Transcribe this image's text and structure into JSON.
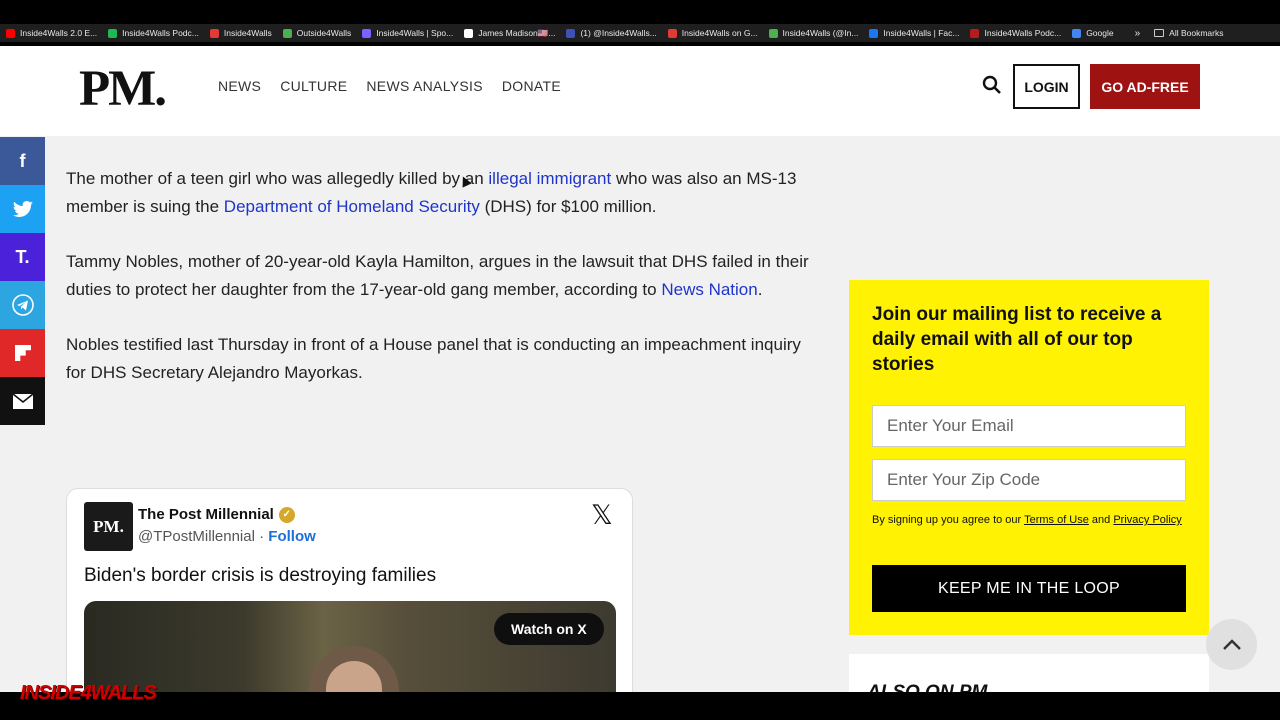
{
  "bookmarks": {
    "items": [
      {
        "label": "Inside4Walls 2.0 E...",
        "color": "#ff0000"
      },
      {
        "label": "Inside4Walls Podc...",
        "color": "#1db954"
      },
      {
        "label": "Inside4Walls",
        "color": "#e53935"
      },
      {
        "label": "Outside4Walls",
        "color": "#4caf50"
      },
      {
        "label": "Inside4Walls | Spo...",
        "color": "#7b61ff"
      },
      {
        "label": "James Madison🇺🇸...",
        "color": "#ffffff"
      },
      {
        "label": "(1) @Inside4Walls...",
        "color": "#3f51b5"
      },
      {
        "label": "Inside4Walls on G...",
        "color": "#e53935"
      },
      {
        "label": "Inside4Walls (@In...",
        "color": "#4caf50"
      },
      {
        "label": "Inside4Walls | Fac...",
        "color": "#1877f2"
      },
      {
        "label": "Inside4Walls Podc...",
        "color": "#b71c1c"
      },
      {
        "label": "Google",
        "color": "#4285f4"
      }
    ],
    "more": "»",
    "all_label": "All Bookmarks"
  },
  "header": {
    "logo": "PM.",
    "nav": [
      "NEWS",
      "CULTURE",
      "NEWS ANALYSIS",
      "DONATE"
    ],
    "login": "LOGIN",
    "ad_free": "GO AD-FREE",
    "accent_color": "#9e1212"
  },
  "share": [
    "facebook-icon",
    "twitter-icon",
    "truth-social-icon",
    "telegram-icon",
    "flipboard-icon",
    "email-icon"
  ],
  "article": {
    "p1_a": "The mother of a teen girl who was allegedly killed by an ",
    "p1_link1": "illegal immigrant",
    "p1_b": " who was also an MS-13 member is suing the ",
    "p1_link2": "Department of Homeland Security",
    "p1_c": " (DHS) for $100 million.",
    "p2_a": "Tammy Nobles, mother of 20-year-old Kayla Hamilton, argues in the lawsuit that DHS failed in their duties to protect her daughter from the 17-year-old gang member, according to ",
    "p2_link": "News Nation",
    "p2_b": ".",
    "p3": "Nobles testified last Thursday in front of a House panel that is conducting an impeachment inquiry for DHS Secretary Alejandro Mayorkas."
  },
  "tweet": {
    "avatar_text": "PM.",
    "name": "The Post Millennial",
    "handle": "@TPostMillennial",
    "separator": " · ",
    "follow": "Follow",
    "text": "Biden's border crisis is destroying families",
    "watch": "Watch on X",
    "x_logo": "𝕏"
  },
  "signup": {
    "title": "Join our mailing list to receive a daily email with all of our top stories",
    "email_placeholder": "Enter Your Email",
    "zip_placeholder": "Enter Your Zip Code",
    "terms_a": "By signing up you agree to our ",
    "terms_link1": "Terms of Use",
    "terms_b": " and ",
    "terms_link2": "Privacy Policy",
    "button": "KEEP ME IN THE LOOP",
    "bg_color": "#fff203"
  },
  "also": {
    "title": "ALSO ON PM."
  },
  "watermark": "INSIDE4WALLS"
}
